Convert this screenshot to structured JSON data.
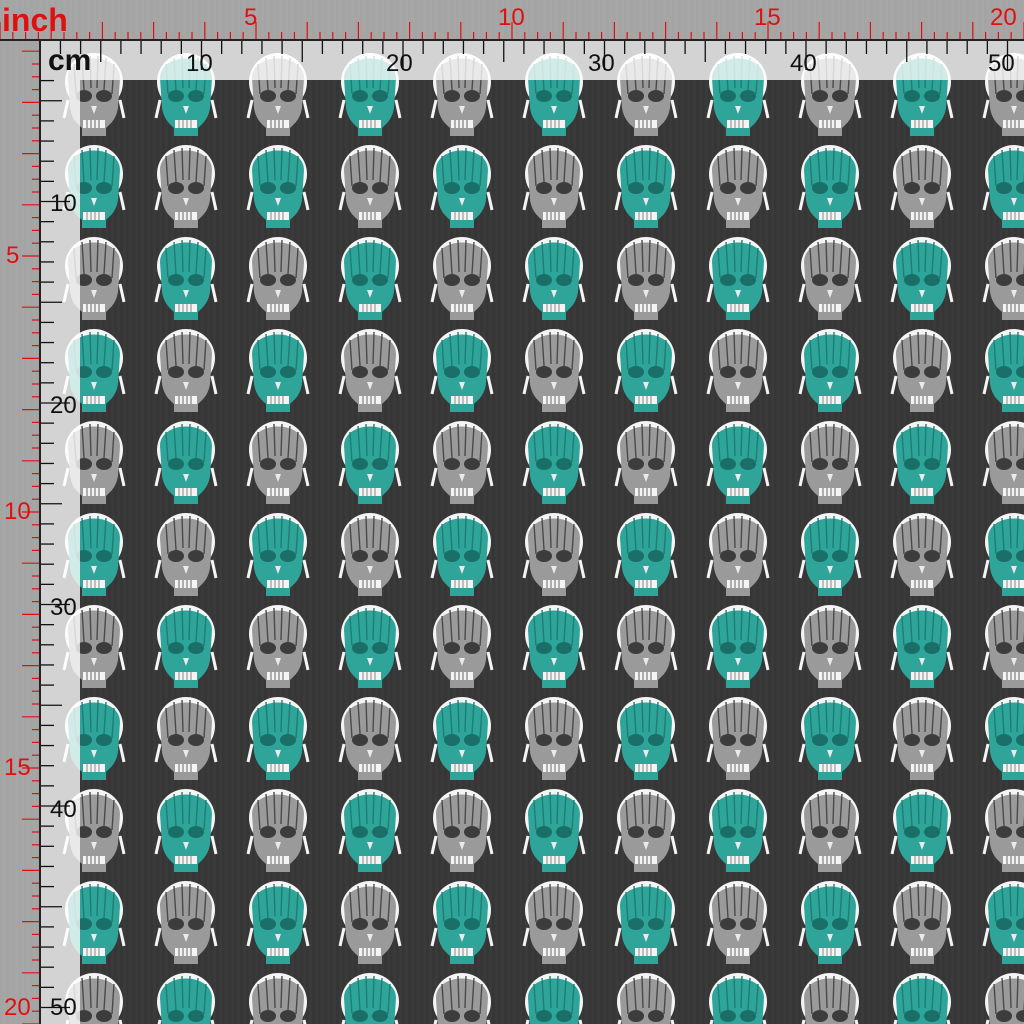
{
  "units": {
    "inch_label": "inch",
    "cm_label": "cm"
  },
  "top_inch_labels": [
    "5",
    "10",
    "15",
    "20"
  ],
  "top_cm_labels": [
    "10",
    "20",
    "30",
    "40",
    "50"
  ],
  "left_inch_labels": [
    "5",
    "10",
    "15",
    "20"
  ],
  "left_cm_labels": [
    "10",
    "20",
    "30",
    "40",
    "50"
  ],
  "colors": {
    "background": "#3a3a3a",
    "teal": "#2fa59a",
    "grey": "#8a8a8a",
    "inch_red": "#e01010"
  },
  "pattern": {
    "motif": "anatomical-skull-icon",
    "columns": 11,
    "rows": 11
  }
}
